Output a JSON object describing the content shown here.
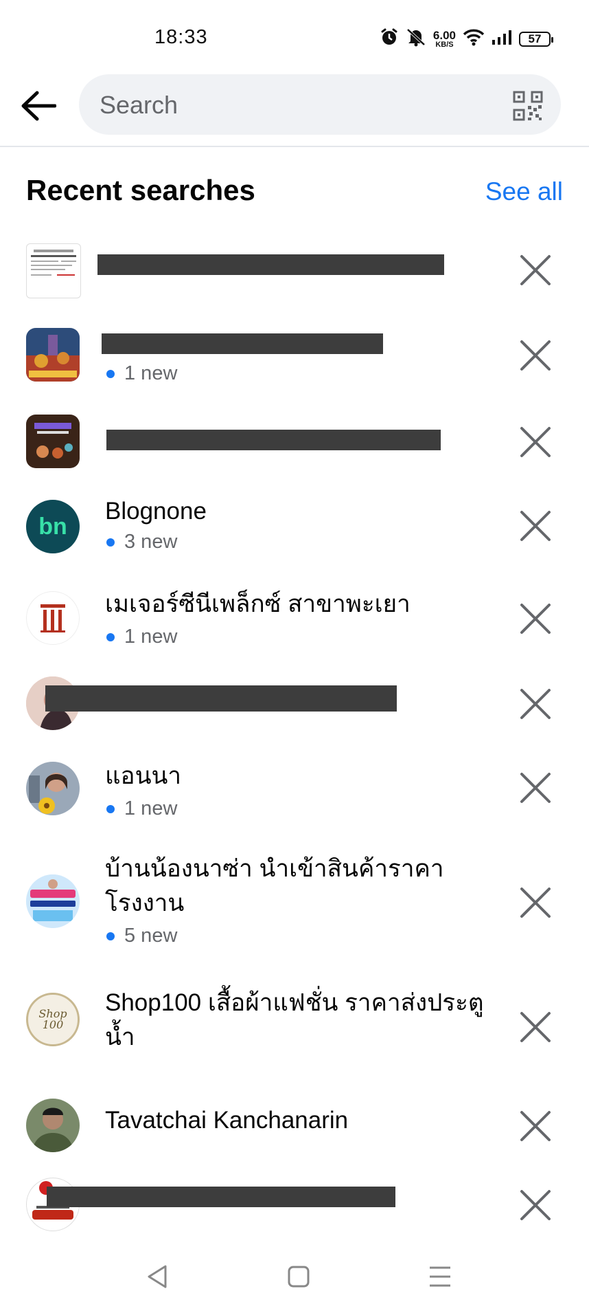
{
  "status_bar": {
    "time": "18:33",
    "net_speed": "6.00",
    "net_unit": "KB/S",
    "battery": "57",
    "icons": [
      "alarm-icon",
      "mute-icon",
      "wifi-icon",
      "signal-icon",
      "battery-icon"
    ]
  },
  "header": {
    "search_placeholder": "Search",
    "back_icon": "arrow-left-icon",
    "qr_icon": "qr-code-icon"
  },
  "recent": {
    "title": "Recent searches",
    "see_all": "See all",
    "items": [
      {
        "name": "",
        "redacted": true,
        "new_label": ""
      },
      {
        "name": "",
        "redacted": true,
        "new_label": "1 new"
      },
      {
        "name": "",
        "redacted": true,
        "new_label": ""
      },
      {
        "name": "Blognone",
        "redacted": false,
        "new_label": "3 new",
        "avatar_text": "bn"
      },
      {
        "name": "เมเจอร์ซีนีเพล็กซ์ สาขาพะเยา",
        "redacted": false,
        "new_label": "1 new"
      },
      {
        "name": "",
        "redacted": true,
        "new_label": ""
      },
      {
        "name": "แอนนา",
        "redacted": false,
        "new_label": "1 new"
      },
      {
        "name": "บ้านน้องนาซ่า นำเข้าสินค้าราคาโรงงาน",
        "redacted": false,
        "new_label": "5 new"
      },
      {
        "name": "Shop100 เสื้อผ้าแฟชั่น ราคาส่งประตูน้ำ",
        "redacted": false,
        "new_label": "",
        "avatar_text": "Shop 100"
      },
      {
        "name": "Tavatchai Kanchanarin",
        "redacted": false,
        "new_label": ""
      },
      {
        "name": "",
        "redacted": true,
        "new_label": ""
      }
    ]
  },
  "navbar": {
    "icons": [
      "back-triangle-icon",
      "home-square-icon",
      "menu-lines-icon"
    ]
  },
  "colors": {
    "accent": "#1877f2",
    "text": "#050505",
    "muted": "#65676b",
    "search_bg": "#f0f2f5",
    "redaction": "#3d3d3d"
  }
}
